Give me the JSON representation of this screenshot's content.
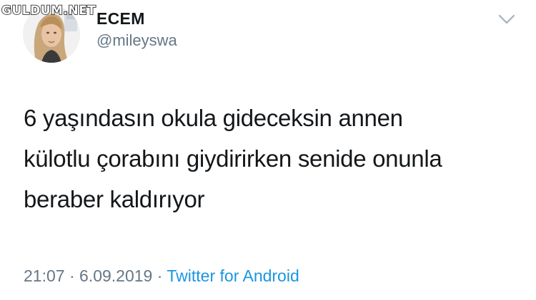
{
  "watermark": "GULDUM.NET",
  "user": {
    "display_name": "ECEM",
    "handle": "@mileyswa"
  },
  "tweet": {
    "text": "6 yaşındasın okula gideceksin annen\nkülotlu çorabını giydirirken senide onunla\nberaber kaldırıyor"
  },
  "meta": {
    "time": "21:07",
    "separator": "·",
    "date": "6.09.2019",
    "source": "Twitter for Android"
  },
  "colors": {
    "text": "#14171a",
    "secondary": "#657786",
    "link": "#1b95e0"
  },
  "icons": {
    "menu": "chevron-down-icon",
    "avatar": "profile-photo"
  }
}
